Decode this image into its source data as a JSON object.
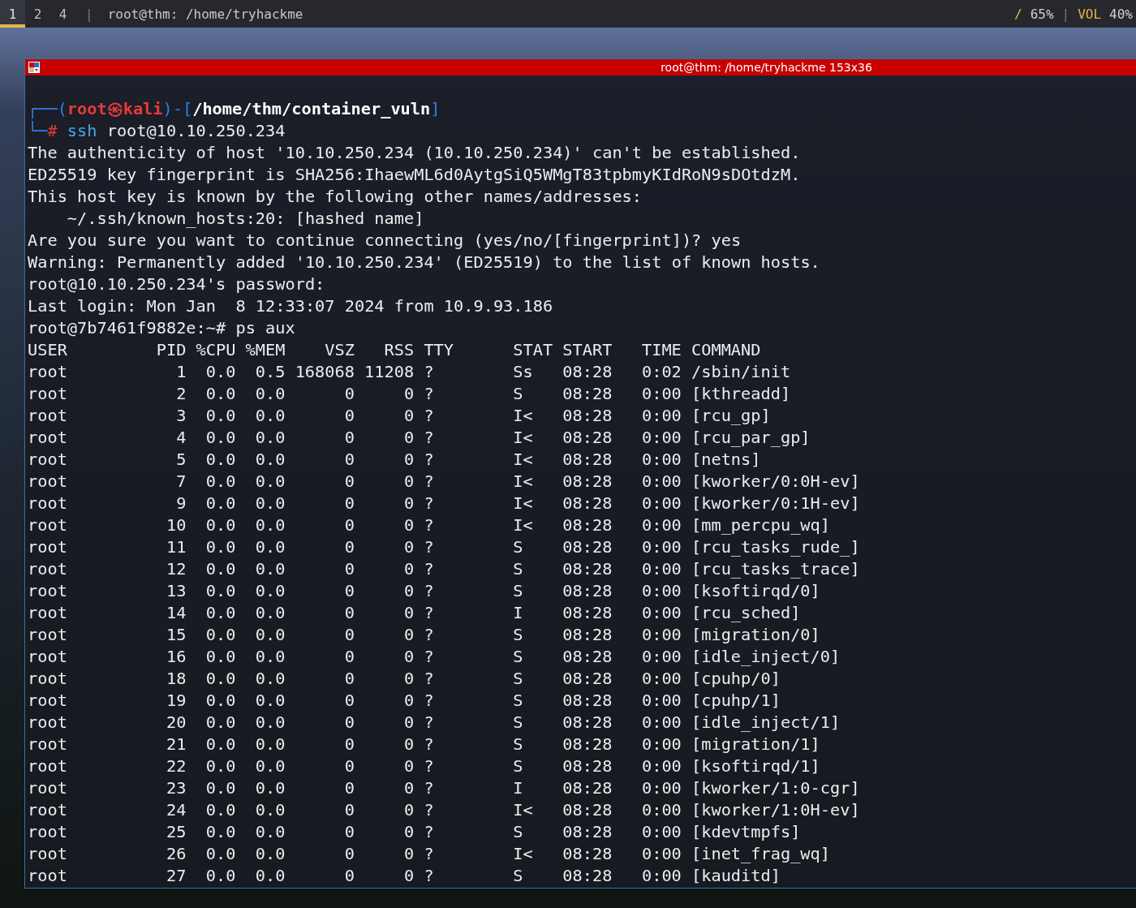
{
  "top_bar": {
    "workspaces": [
      {
        "label": "1",
        "selected": true
      },
      {
        "label": "2",
        "selected": false
      },
      {
        "label": "4",
        "selected": false
      }
    ],
    "separator": "|",
    "title": "root@thm: /home/tryhackme",
    "status": [
      {
        "kind": "label",
        "text": "/"
      },
      {
        "kind": "value",
        "text": "65%"
      },
      {
        "kind": "separator",
        "text": "|"
      },
      {
        "kind": "label",
        "text": "VOL"
      },
      {
        "kind": "value",
        "text": "40%"
      }
    ]
  },
  "terminal": {
    "title": "root@thm: /home/tryhackme 153x36",
    "prompt": [
      [
        {
          "kind": "frame",
          "text": "┌──("
        },
        {
          "kind": "user",
          "text": "root㉿kali"
        },
        {
          "kind": "frame",
          "text": ")-["
        },
        {
          "kind": "path",
          "text": "/home/thm/container_vuln"
        },
        {
          "kind": "frame",
          "text": "]"
        }
      ],
      [
        {
          "kind": "frame",
          "text": "└─"
        },
        {
          "kind": "hash",
          "text": "#"
        },
        {
          "kind": "command",
          "text": "ssh"
        },
        {
          "kind": "plain",
          "text": " root@10.10.250.234"
        }
      ]
    ],
    "output": [
      "The authenticity of host '10.10.250.234 (10.10.250.234)' can't be established.",
      "ED25519 key fingerprint is SHA256:IhaewML6d0AytgSiQ5WMgT83tpbmyKIdRoN9sDOtdzM.",
      "This host key is known by the following other names/addresses:",
      "    ~/.ssh/known_hosts:20: [hashed name]",
      "Are you sure you want to continue connecting (yes/no/[fingerprint])? yes",
      "Warning: Permanently added '10.10.250.234' (ED25519) to the list of known hosts.",
      "root@10.10.250.234's password:",
      "Last login: Mon Jan  8 12:33:07 2024 from 10.9.93.186",
      "root@7b7461f9882e:~# ps aux"
    ],
    "ps": {
      "columns": [
        "USER",
        "PID",
        "%CPU",
        "%MEM",
        "VSZ",
        "RSS",
        "TTY",
        "STAT",
        "START",
        "TIME",
        "COMMAND"
      ],
      "rows": [
        [
          "root",
          "1",
          "0.0",
          "0.5",
          "168068",
          "11208",
          "?",
          "Ss",
          "08:28",
          "0:02",
          "/sbin/init"
        ],
        [
          "root",
          "2",
          "0.0",
          "0.0",
          "0",
          "0",
          "?",
          "S",
          "08:28",
          "0:00",
          "[kthreadd]"
        ],
        [
          "root",
          "3",
          "0.0",
          "0.0",
          "0",
          "0",
          "?",
          "I<",
          "08:28",
          "0:00",
          "[rcu_gp]"
        ],
        [
          "root",
          "4",
          "0.0",
          "0.0",
          "0",
          "0",
          "?",
          "I<",
          "08:28",
          "0:00",
          "[rcu_par_gp]"
        ],
        [
          "root",
          "5",
          "0.0",
          "0.0",
          "0",
          "0",
          "?",
          "I<",
          "08:28",
          "0:00",
          "[netns]"
        ],
        [
          "root",
          "7",
          "0.0",
          "0.0",
          "0",
          "0",
          "?",
          "I<",
          "08:28",
          "0:00",
          "[kworker/0:0H-ev]"
        ],
        [
          "root",
          "9",
          "0.0",
          "0.0",
          "0",
          "0",
          "?",
          "I<",
          "08:28",
          "0:00",
          "[kworker/0:1H-ev]"
        ],
        [
          "root",
          "10",
          "0.0",
          "0.0",
          "0",
          "0",
          "?",
          "I<",
          "08:28",
          "0:00",
          "[mm_percpu_wq]"
        ],
        [
          "root",
          "11",
          "0.0",
          "0.0",
          "0",
          "0",
          "?",
          "S",
          "08:28",
          "0:00",
          "[rcu_tasks_rude_]"
        ],
        [
          "root",
          "12",
          "0.0",
          "0.0",
          "0",
          "0",
          "?",
          "S",
          "08:28",
          "0:00",
          "[rcu_tasks_trace]"
        ],
        [
          "root",
          "13",
          "0.0",
          "0.0",
          "0",
          "0",
          "?",
          "S",
          "08:28",
          "0:00",
          "[ksoftirqd/0]"
        ],
        [
          "root",
          "14",
          "0.0",
          "0.0",
          "0",
          "0",
          "?",
          "I",
          "08:28",
          "0:00",
          "[rcu_sched]"
        ],
        [
          "root",
          "15",
          "0.0",
          "0.0",
          "0",
          "0",
          "?",
          "S",
          "08:28",
          "0:00",
          "[migration/0]"
        ],
        [
          "root",
          "16",
          "0.0",
          "0.0",
          "0",
          "0",
          "?",
          "S",
          "08:28",
          "0:00",
          "[idle_inject/0]"
        ],
        [
          "root",
          "18",
          "0.0",
          "0.0",
          "0",
          "0",
          "?",
          "S",
          "08:28",
          "0:00",
          "[cpuhp/0]"
        ],
        [
          "root",
          "19",
          "0.0",
          "0.0",
          "0",
          "0",
          "?",
          "S",
          "08:28",
          "0:00",
          "[cpuhp/1]"
        ],
        [
          "root",
          "20",
          "0.0",
          "0.0",
          "0",
          "0",
          "?",
          "S",
          "08:28",
          "0:00",
          "[idle_inject/1]"
        ],
        [
          "root",
          "21",
          "0.0",
          "0.0",
          "0",
          "0",
          "?",
          "S",
          "08:28",
          "0:00",
          "[migration/1]"
        ],
        [
          "root",
          "22",
          "0.0",
          "0.0",
          "0",
          "0",
          "?",
          "S",
          "08:28",
          "0:00",
          "[ksoftirqd/1]"
        ],
        [
          "root",
          "23",
          "0.0",
          "0.0",
          "0",
          "0",
          "?",
          "I",
          "08:28",
          "0:00",
          "[kworker/1:0-cgr]"
        ],
        [
          "root",
          "24",
          "0.0",
          "0.0",
          "0",
          "0",
          "?",
          "I<",
          "08:28",
          "0:00",
          "[kworker/1:0H-ev]"
        ],
        [
          "root",
          "25",
          "0.0",
          "0.0",
          "0",
          "0",
          "?",
          "S",
          "08:28",
          "0:00",
          "[kdevtmpfs]"
        ],
        [
          "root",
          "26",
          "0.0",
          "0.0",
          "0",
          "0",
          "?",
          "I<",
          "08:28",
          "0:00",
          "[inet_frag_wq]"
        ],
        [
          "root",
          "27",
          "0.0",
          "0.0",
          "0",
          "0",
          "?",
          "S",
          "08:28",
          "0:00",
          "[kauditd]"
        ]
      ]
    }
  }
}
